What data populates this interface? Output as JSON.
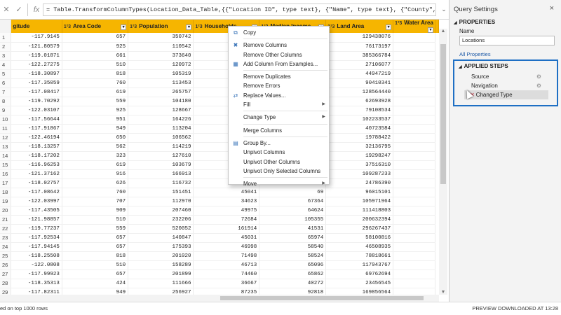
{
  "formula_bar": {
    "cancel_icon": "close-icon",
    "commit_icon": "check-icon",
    "fx": "fx",
    "formula": "= Table.TransformColumnTypes(Location_Data_Table,{{\"Location ID\", type text}, {\"Name\", type text}, {\"County\", type text}, {\"State",
    "expand_icon": "chevron-down-icon"
  },
  "grid": {
    "columns": [
      {
        "label": "gitude",
        "type": ""
      },
      {
        "label": "Area Code",
        "type": "1²3"
      },
      {
        "label": "Population",
        "type": "1²3"
      },
      {
        "label": "Households",
        "type": "1²3"
      },
      {
        "label": "Median Income",
        "type": "1²3"
      },
      {
        "label": "Land Area",
        "type": "1²3"
      },
      {
        "label": "Water Area",
        "type": "1²3"
      }
    ],
    "rows": [
      [
        "-117.9145",
        "657",
        "350742",
        "",
        "52",
        "129438076",
        ""
      ],
      [
        "-121.80579",
        "925",
        "110542",
        "",
        "20",
        "76173197",
        ""
      ],
      [
        "-119.01871",
        "661",
        "373640",
        "",
        "95",
        "385366784",
        ""
      ],
      [
        "-122.27275",
        "510",
        "120972",
        "",
        "97",
        "27106077",
        ""
      ],
      [
        "-118.30897",
        "818",
        "105319",
        "",
        "76",
        "44947219",
        ""
      ],
      [
        "-117.35059",
        "760",
        "113453",
        "",
        "97",
        "90410341",
        ""
      ],
      [
        "-117.08417",
        "619",
        "265757",
        "",
        "35",
        "128564440",
        ""
      ],
      [
        "-119.70292",
        "559",
        "104180",
        "",
        "68",
        "62693928",
        ""
      ],
      [
        "-122.03107",
        "925",
        "128667",
        "",
        "91",
        "79108534",
        ""
      ],
      [
        "-117.56644",
        "951",
        "164226",
        "",
        "49",
        "102233537",
        ""
      ],
      [
        "-117.91867",
        "949",
        "113204",
        "",
        "59",
        "40723584",
        ""
      ],
      [
        "-122.46194",
        "650",
        "106562",
        "",
        "49",
        "19788422",
        ""
      ],
      [
        "-118.13257",
        "562",
        "114219",
        "",
        "44",
        "32136795",
        ""
      ],
      [
        "-118.17202",
        "323",
        "127610",
        "",
        "66",
        "19298247",
        ""
      ],
      [
        "-116.96253",
        "619",
        "103679",
        "",
        "61",
        "37516310",
        ""
      ],
      [
        "-121.37162",
        "916",
        "166913",
        "",
        "97",
        "109287233",
        ""
      ],
      [
        "-118.02757",
        "626",
        "116732",
        "",
        "99",
        "24786390",
        ""
      ],
      [
        "-117.08642",
        "760",
        "151451",
        "45041",
        "69",
        "96015101",
        ""
      ],
      [
        "-122.03997",
        "707",
        "112970",
        "34623",
        "67364",
        "105971964",
        ""
      ],
      [
        "-117.43505",
        "909",
        "207460",
        "49975",
        "64624",
        "111418803",
        ""
      ],
      [
        "-121.98857",
        "510",
        "232206",
        "72684",
        "105355",
        "200632394",
        ""
      ],
      [
        "-119.77237",
        "559",
        "520052",
        "161914",
        "41531",
        "296267437",
        ""
      ],
      [
        "-117.92534",
        "657",
        "140847",
        "45031",
        "65974",
        "58100816",
        ""
      ],
      [
        "-117.94145",
        "657",
        "175393",
        "46998",
        "58540",
        "46508935",
        ""
      ],
      [
        "-118.25508",
        "818",
        "201020",
        "71498",
        "58524",
        "78818661",
        ""
      ],
      [
        "-122.0808",
        "510",
        "158289",
        "46713",
        "65096",
        "117943767",
        ""
      ],
      [
        "-117.99923",
        "657",
        "201899",
        "74460",
        "65862",
        "69762694",
        ""
      ],
      [
        "-118.35313",
        "424",
        "111666",
        "36667",
        "40272",
        "23456545",
        ""
      ],
      [
        "-117.82311",
        "949",
        "256927",
        "87235",
        "92818",
        "169856564",
        ""
      ],
      [
        "",
        "",
        "",
        "",
        "",
        "",
        ""
      ]
    ]
  },
  "context_menu": {
    "items": [
      {
        "label": "Copy",
        "icon": "copy-icon",
        "submenu": false
      },
      {
        "sep": true
      },
      {
        "label": "Remove Columns",
        "icon": "remove-columns-icon",
        "submenu": false
      },
      {
        "label": "Remove Other Columns",
        "icon": "",
        "submenu": false
      },
      {
        "label": "Add Column From Examples...",
        "icon": "add-column-icon",
        "submenu": false
      },
      {
        "sep": true
      },
      {
        "label": "Remove Duplicates",
        "icon": "",
        "submenu": false
      },
      {
        "label": "Remove Errors",
        "icon": "",
        "submenu": false
      },
      {
        "label": "Replace Values...",
        "icon": "replace-values-icon",
        "submenu": false
      },
      {
        "label": "Fill",
        "icon": "",
        "submenu": true
      },
      {
        "sep": true
      },
      {
        "label": "Change Type",
        "icon": "",
        "submenu": true
      },
      {
        "sep": true
      },
      {
        "label": "Merge Columns",
        "icon": "",
        "submenu": false
      },
      {
        "sep": true
      },
      {
        "label": "Group By...",
        "icon": "group-by-icon",
        "submenu": false
      },
      {
        "label": "Unpivot Columns",
        "icon": "",
        "submenu": false
      },
      {
        "label": "Unpivot Other Columns",
        "icon": "",
        "submenu": false
      },
      {
        "label": "Unpivot Only Selected Columns",
        "icon": "",
        "submenu": false
      },
      {
        "sep": true
      },
      {
        "label": "Move",
        "icon": "",
        "submenu": true
      }
    ]
  },
  "query_settings": {
    "title": "Query Settings",
    "close": "×",
    "properties_header": "PROPERTIES",
    "name_label": "Name",
    "name_value": "Locations",
    "all_properties": "All Properties",
    "applied_steps_header": "APPLIED STEPS",
    "steps": [
      {
        "label": "Source",
        "gear": true,
        "selected": false
      },
      {
        "label": "Navigation",
        "gear": true,
        "selected": false
      },
      {
        "label": "Changed Type",
        "gear": false,
        "selected": true
      }
    ]
  },
  "status_bar": {
    "left": "ed on top 1000 rows",
    "right": "PREVIEW DOWNLOADED AT 13:28"
  }
}
